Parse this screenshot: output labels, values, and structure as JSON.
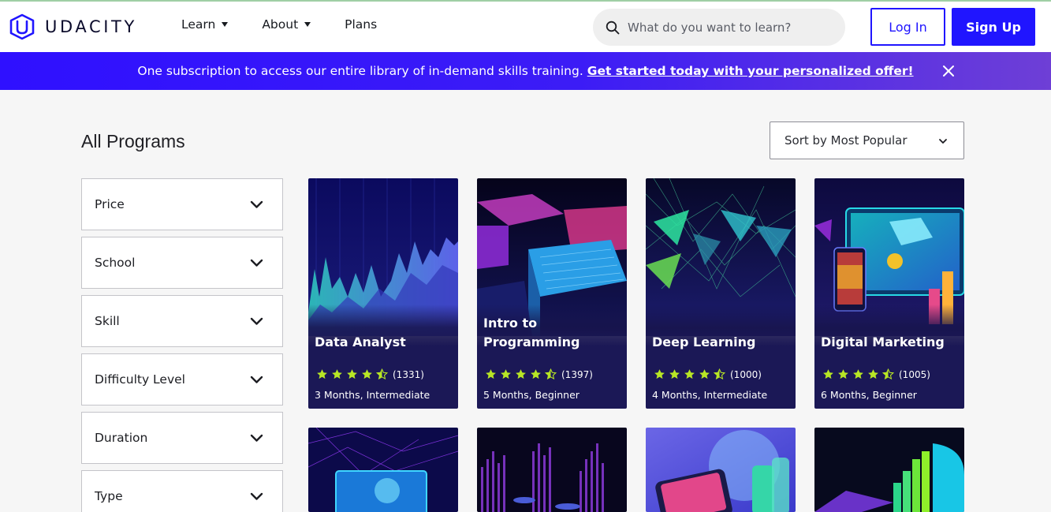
{
  "header": {
    "logo_text": "UDACITY",
    "nav": [
      {
        "label": "Learn",
        "has_menu": true
      },
      {
        "label": "About",
        "has_menu": true
      },
      {
        "label": "Plans",
        "has_menu": false
      }
    ],
    "search_placeholder": "What do you want to learn?",
    "login_label": "Log In",
    "signup_label": "Sign Up"
  },
  "banner": {
    "text": "One subscription to access our entire library of in-demand skills training.",
    "cta": "Get started today with your personalized offer!"
  },
  "main": {
    "title": "All Programs",
    "sort_label": "Sort by Most Popular",
    "filters": [
      "Price",
      "School",
      "Skill",
      "Difficulty Level",
      "Duration",
      "Type"
    ]
  },
  "cards": [
    {
      "title": "Data Analyst",
      "rating": 4.5,
      "reviews": "(1331)",
      "meta": "3 Months, Intermediate"
    },
    {
      "title": "Intro to Programming",
      "rating": 4.5,
      "reviews": "(1397)",
      "meta": "5 Months, Beginner"
    },
    {
      "title": "Deep Learning",
      "rating": 4.5,
      "reviews": "(1000)",
      "meta": "4 Months, Intermediate"
    },
    {
      "title": "Digital Marketing",
      "rating": 4.5,
      "reviews": "(1005)",
      "meta": "6 Months, Beginner"
    }
  ],
  "colors": {
    "brand_blue": "#2015ff",
    "card_bg": "#1b1856",
    "star": "#b8e625",
    "banner_start": "#2f10ff",
    "banner_end": "#6e3fd6"
  },
  "icons": {
    "search": "search-icon",
    "close": "close-icon",
    "chevron": "chevron-down-icon",
    "star": "star-icon",
    "logo": "udacity-logo-icon"
  }
}
